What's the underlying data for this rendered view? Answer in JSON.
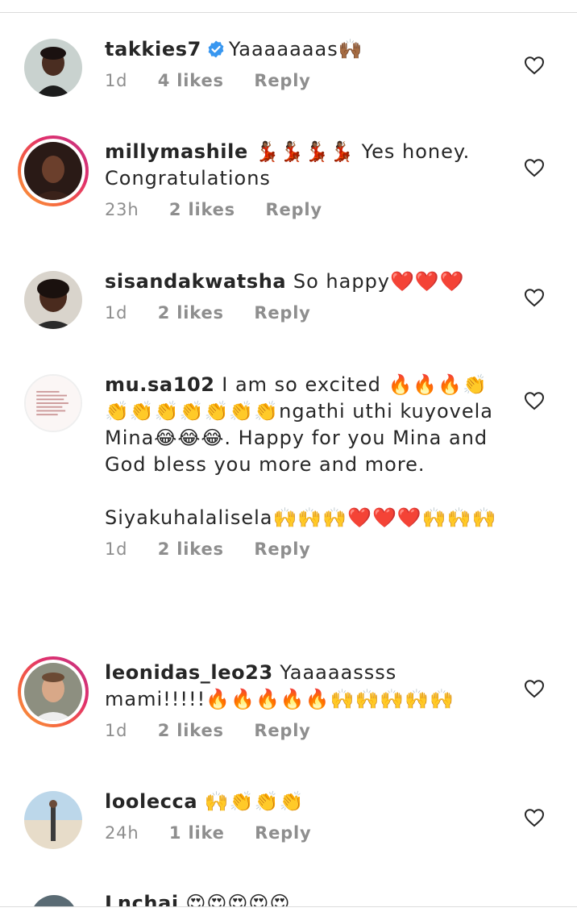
{
  "comments": [
    {
      "username": "takkies7",
      "verified": true,
      "text": "Yaaaaaaas🙌🏾",
      "time": "1d",
      "likes": "4 likes",
      "reply": "Reply"
    },
    {
      "username": "millymashile",
      "verified": false,
      "text": "💃🏾💃🏾💃🏾💃🏾 Yes honey. Congratulations",
      "time": "23h",
      "likes": "2 likes",
      "reply": "Reply"
    },
    {
      "username": "sisandakwatsha",
      "verified": false,
      "text": "So happy❤️❤️❤️",
      "time": "1d",
      "likes": "2 likes",
      "reply": "Reply"
    },
    {
      "username": "mu.sa102",
      "verified": false,
      "text": "I am so excited 🔥🔥🔥👏👏👏👏👏👏👏👏ngathi uthi kuyovela Mina😂😂😂. Happy for you Mina and God bless you more and more.\n\nSiyakuhalalisela🙌🙌🙌❤️❤️❤️🙌🙌🙌",
      "time": "1d",
      "likes": "2 likes",
      "reply": "Reply"
    },
    {
      "username": "leonidas_leo23",
      "verified": false,
      "text": "Yaaaaassss mami!!!!!🔥🔥🔥🔥🔥🙌🙌🙌🙌🙌",
      "time": "1d",
      "likes": "2 likes",
      "reply": "Reply"
    },
    {
      "username": "loolecca",
      "verified": false,
      "text": "🙌👏👏👏",
      "time": "24h",
      "likes": "1 like",
      "reply": "Reply"
    },
    {
      "username": "Lnchai",
      "verified": false,
      "text": "😍😍😍😍😍"
    }
  ],
  "colors": {
    "text": "#262626",
    "meta": "#8e8e8e",
    "verified": "#3897f0",
    "divider": "#dbdbdb"
  }
}
